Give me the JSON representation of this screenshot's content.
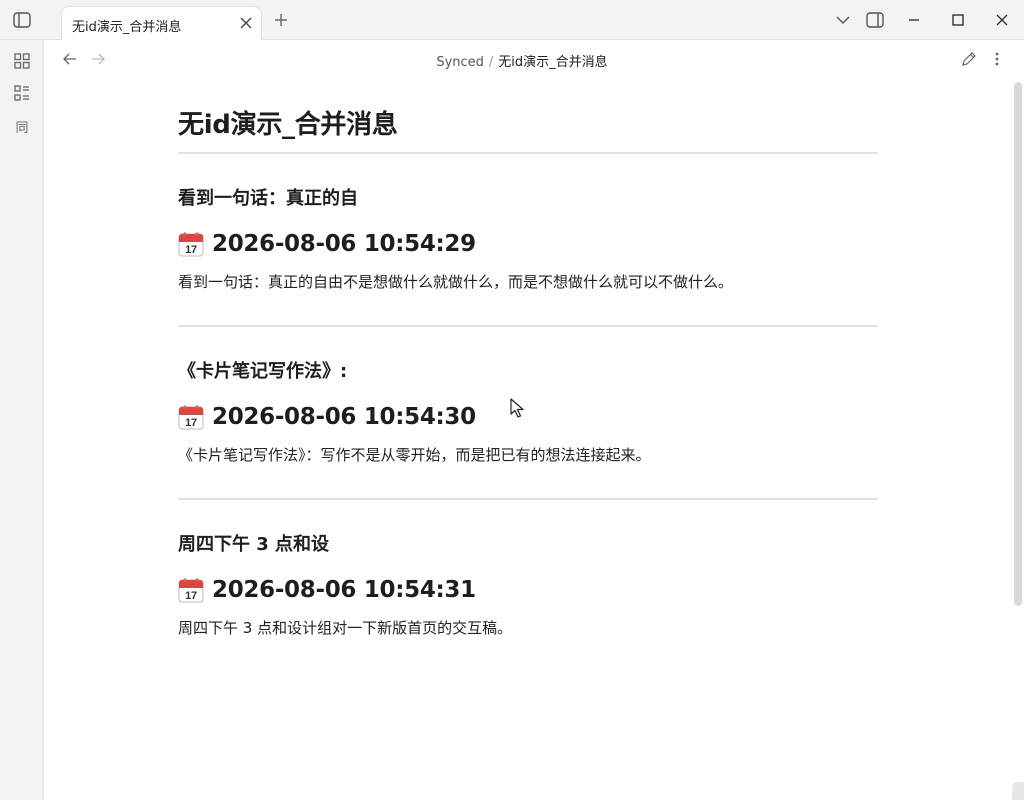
{
  "tab": {
    "title": "无id演示_合并消息"
  },
  "breadcrumb": {
    "folder": "Synced",
    "separator": "/",
    "current": "无id演示_合并消息"
  },
  "ribbon": {
    "sync_label": "同"
  },
  "note": {
    "title": "无id演示_合并消息",
    "entries": [
      {
        "heading": "看到一句话：真正的自",
        "date": "2026-08-06 10:54:29",
        "body": "看到一句话：真正的自由不是想做什么就做什么，而是不想做什么就可以不做什么。"
      },
      {
        "heading": "《卡片笔记写作法》:",
        "date": "2026-08-06 10:54:30",
        "body": "《卡片笔记写作法》：写作不是从零开始，而是把已有的想法连接起来。"
      },
      {
        "heading": "周四下午 3 点和设",
        "date": "2026-08-06 10:54:31",
        "body": "周四下午 3 点和设计组对一下新版首页的交互稿。"
      }
    ]
  },
  "icons": {
    "sidebar_toggle": "sidebar-toggle-icon",
    "calendar": "calendar-icon",
    "colors": {
      "calendar_red": "#e0443e"
    }
  }
}
